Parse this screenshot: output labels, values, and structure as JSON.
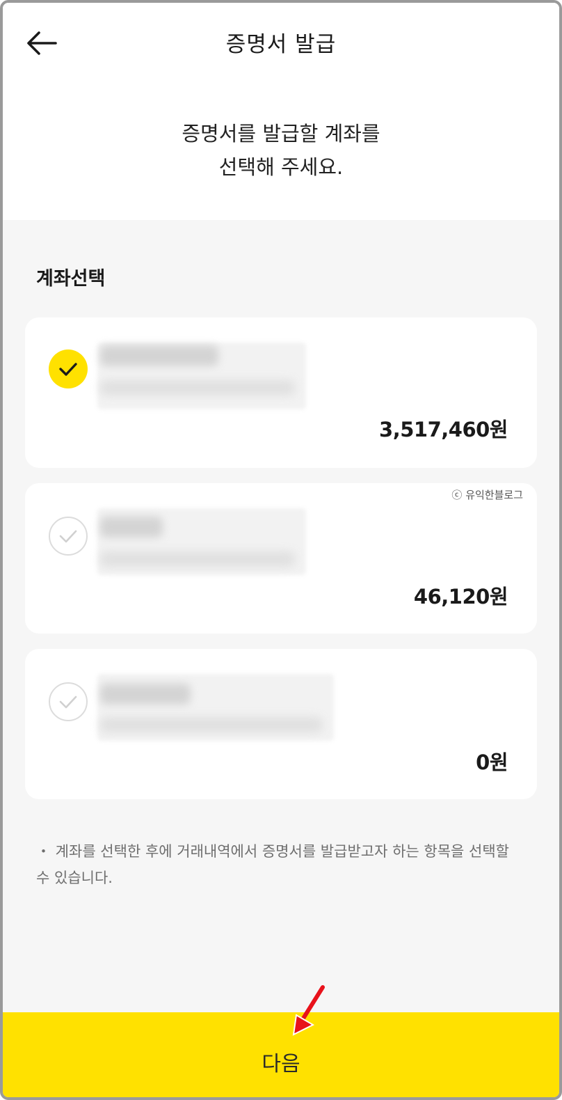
{
  "header": {
    "title": "증명서 발급",
    "instruction_line1": "증명서를 발급할 계좌를",
    "instruction_line2": "선택해 주세요."
  },
  "section": {
    "title": "계좌선택"
  },
  "accounts": [
    {
      "selected": true,
      "amount": "3,517,460원"
    },
    {
      "selected": false,
      "amount": "46,120원"
    },
    {
      "selected": false,
      "amount": "0원"
    }
  ],
  "watermark": "ⓒ 유익한블로그",
  "notice": "・ 계좌를 선택한 후에 거래내역에서 증명서를 발급받고자 하는 항목을 선택할 수 있습니다.",
  "footer": {
    "next_label": "다음"
  },
  "colors": {
    "accent": "#ffe100",
    "background": "#f6f6f6",
    "annotation": "#e8121b"
  },
  "icons": {
    "back": "arrow-left-icon",
    "selected": "check-circle-filled-icon",
    "unselected": "check-circle-outline-icon"
  }
}
